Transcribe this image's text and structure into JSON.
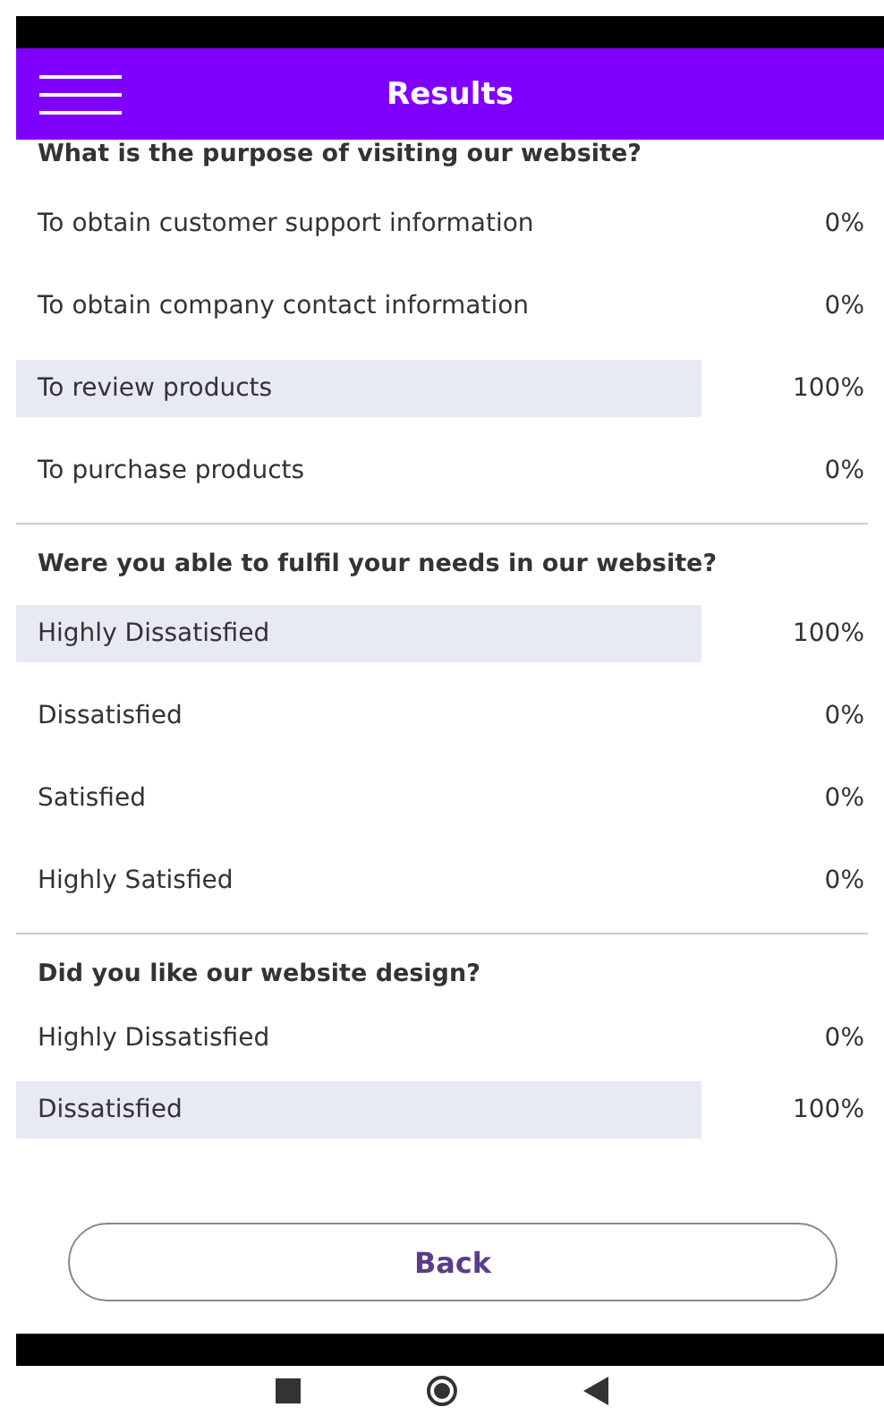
{
  "header": {
    "title": "Results"
  },
  "questions": [
    {
      "question": "What is the purpose of visiting our website?",
      "answers": [
        {
          "label": "To obtain customer support information",
          "percent": "0%",
          "selected": false
        },
        {
          "label": "To obtain company contact information",
          "percent": "0%",
          "selected": false
        },
        {
          "label": "To review products",
          "percent": "100%",
          "selected": true
        },
        {
          "label": "To purchase products",
          "percent": "0%",
          "selected": false
        }
      ]
    },
    {
      "question": "Were you able to fulfil your needs in our website?",
      "answers": [
        {
          "label": "Highly Dissatisfied",
          "percent": "100%",
          "selected": true
        },
        {
          "label": "Dissatisfied",
          "percent": "0%",
          "selected": false
        },
        {
          "label": "Satisfied",
          "percent": "0%",
          "selected": false
        },
        {
          "label": "Highly Satisfied",
          "percent": "0%",
          "selected": false
        }
      ]
    },
    {
      "question": "Did you like our website design?",
      "answers": [
        {
          "label": "Highly Dissatisfied",
          "percent": "0%",
          "selected": false
        },
        {
          "label": "Dissatisfied",
          "percent": "100%",
          "selected": true
        }
      ]
    }
  ],
  "back_button": "Back"
}
